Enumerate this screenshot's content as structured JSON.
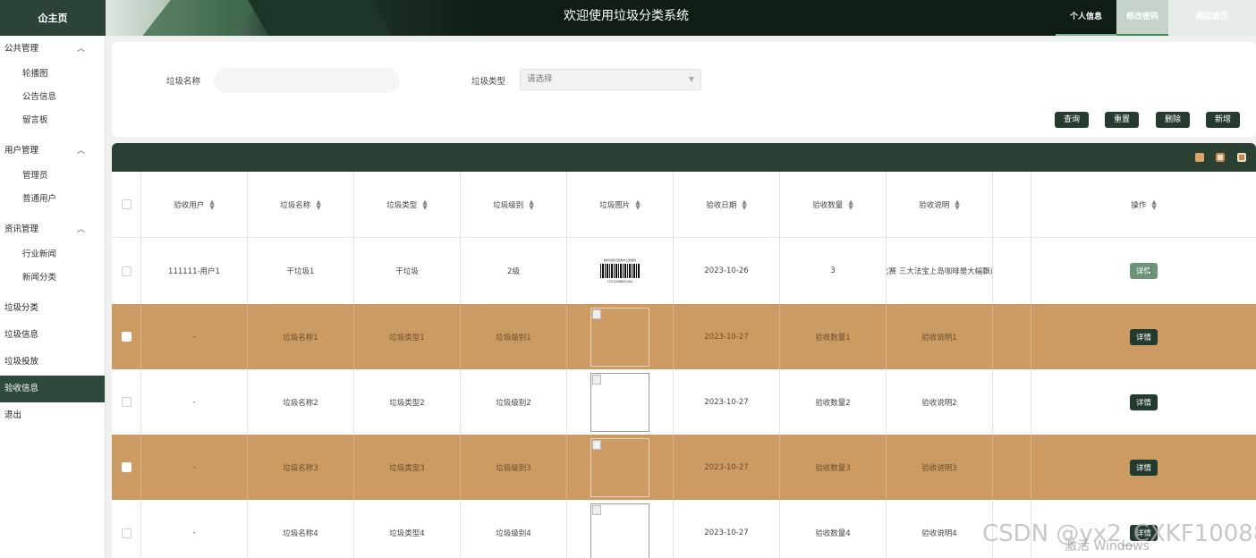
{
  "header": {
    "brand": "仚主页",
    "site_title": "欢迎使用垃圾分类系统",
    "nav": [
      "个人信息",
      "修改密码",
      "网站首页"
    ]
  },
  "sidebar": {
    "groups": [
      {
        "label": "公共管理",
        "items": [
          "轮播图",
          "公告信息",
          "留言板"
        ]
      },
      {
        "label": "用户管理",
        "items": [
          "管理员",
          "普通用户"
        ]
      },
      {
        "label": "资讯管理",
        "items": [
          "行业新闻",
          "新闻分类"
        ]
      }
    ],
    "items": [
      "垃圾分类",
      "垃圾信息",
      "垃圾投放",
      "验收信息",
      "退出"
    ],
    "active": "验收信息"
  },
  "search": {
    "name_label": "垃圾名称",
    "name_value": "",
    "type_label": "垃圾类型",
    "type_placeholder": "请选择",
    "buttons": [
      "查询",
      "重置",
      "删除",
      "新增"
    ]
  },
  "table": {
    "columns": [
      "验收用户",
      "垃圾名称",
      "垃圾类型",
      "垃圾级别",
      "垃圾图片",
      "验收日期",
      "验收数量",
      "验收说明",
      "",
      "操作"
    ],
    "rows": [
      {
        "user": "111111-用户1",
        "name": "干垃圾1",
        "type": "干垃圾",
        "level": "2级",
        "date": "2023-10-26",
        "qty": "3",
        "desc": "比赛 三大法宝上岛咖啡是大幅飘逸",
        "action": "详情"
      },
      {
        "user": "-",
        "name": "垃圾名称1",
        "type": "垃圾类型1",
        "level": "垃圾级别1",
        "date": "2023-10-27",
        "qty": "验收数量1",
        "desc": "验收说明1",
        "action": "详情"
      },
      {
        "user": "-",
        "name": "垃圾名称2",
        "type": "垃圾类型2",
        "level": "垃圾级别2",
        "date": "2023-10-27",
        "qty": "验收数量2",
        "desc": "验收说明2",
        "action": "详情"
      },
      {
        "user": "-",
        "name": "垃圾名称3",
        "type": "垃圾类型3",
        "level": "垃圾级别3",
        "date": "2023-10-27",
        "qty": "验收数量3",
        "desc": "验收说明3",
        "action": "详情"
      },
      {
        "user": "-",
        "name": "垃圾名称4",
        "type": "垃圾类型4",
        "level": "垃圾级别4",
        "date": "2023-10-27",
        "qty": "验收数量4",
        "desc": "验收说明4",
        "action": "详情"
      }
    ],
    "barcode_caption": "精华垃圾可回收中心回收码",
    "barcode_number": "7221456882584",
    "toolbar_icons": [
      "calculator-icon",
      "image-icon",
      "export-icon"
    ]
  },
  "overlay": {
    "watermark": "CSDN @yx2_CXKF10088",
    "activate": "激活 Windows"
  },
  "colors": {
    "primary": "#263b30",
    "row_alt": "#cb9b63",
    "active_menu": "#2e4a3c"
  }
}
